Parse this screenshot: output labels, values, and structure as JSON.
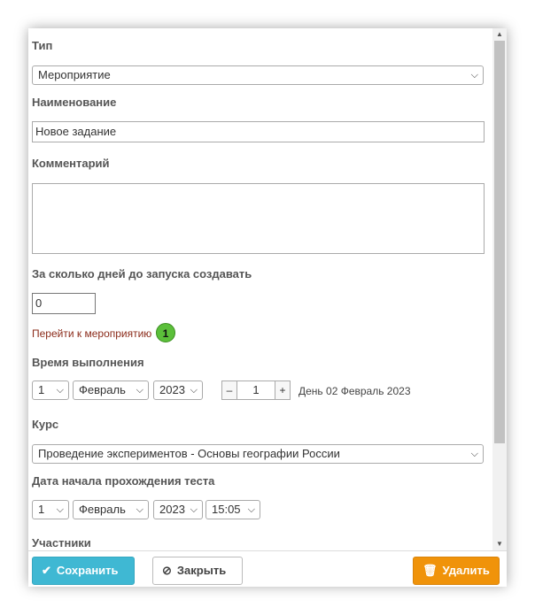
{
  "form": {
    "type_label": "Тип",
    "type_value": "Мероприятие",
    "name_label": "Наименование",
    "name_value": "Новое задание",
    "comment_label": "Комментарий",
    "comment_value": "",
    "days_label": "За сколько дней до запуска создавать",
    "days_value": "0",
    "event_link": "Перейти к мероприятию",
    "badge_count": "1",
    "time_label": "Время выполнения",
    "time_day": "1",
    "time_month": "Февраль",
    "time_year": "2023",
    "stepper_minus": "–",
    "stepper_value": "1",
    "stepper_plus": "+",
    "day_text": "День 02 Февраль 2023",
    "course_label": "Курс",
    "course_value": "Проведение экспериментов - Основы географии России",
    "test_start_label": "Дата начала прохождения теста",
    "test_day": "1",
    "test_month": "Февраль",
    "test_year": "2023",
    "test_time": "15:05",
    "participants_label": "Участники"
  },
  "footer": {
    "save_label": "Сохранить",
    "close_label": "Закрыть",
    "delete_label": "Удалить"
  },
  "colors": {
    "save": "#3fb8d3",
    "delete": "#f0930a",
    "link": "#8b2b1a",
    "badge": "#5bbf3a"
  },
  "icons": {
    "save": "check-icon",
    "close": "ban-icon",
    "delete": "trash-icon",
    "select": "chevron-down-icon"
  }
}
